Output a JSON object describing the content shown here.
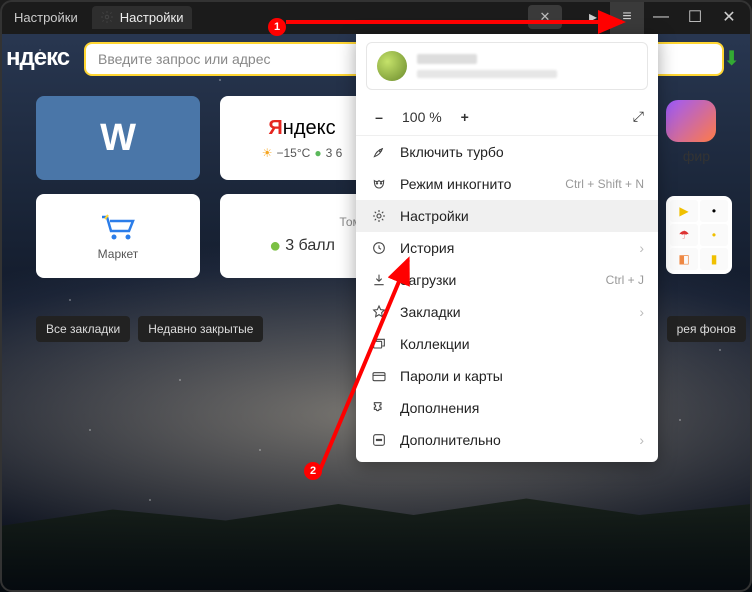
{
  "tabs": {
    "pinned": "Настройки",
    "active": "Настройки"
  },
  "window": {
    "hamburger": "≡",
    "minimize": "—",
    "maximize": "☐",
    "close": "✕"
  },
  "logo": "ндекс",
  "search": {
    "placeholder": "Введите запрос или адрес"
  },
  "tiles": {
    "vk": "VK",
    "yandex": {
      "title_prefix": "Я",
      "title_rest": "ндекс",
      "temp": "−15°C",
      "time_prefix": "3 6"
    },
    "tomsk": {
      "city": "Томск",
      "score": "3 балл"
    },
    "market": "Маркет",
    "efir": "фир"
  },
  "chips": {
    "all": "Все закладки",
    "recent": "Недавно закрытые",
    "gallery": "рея фонов"
  },
  "menu": {
    "zoom": {
      "minus": "–",
      "value": "100 %",
      "plus": "+"
    },
    "turbo": "Включить турбо",
    "incognito": {
      "label": "Режим инкогнито",
      "shortcut": "Ctrl + Shift + N"
    },
    "settings": "Настройки",
    "history": "История",
    "downloads": {
      "label": "Загрузки",
      "shortcut": "Ctrl + J"
    },
    "bookmarks": "Закладки",
    "collections": "Коллекции",
    "passwords": "Пароли и карты",
    "addons": "Дополнения",
    "more": "Дополнительно"
  },
  "annotations": {
    "step1": "1",
    "step2": "2"
  }
}
